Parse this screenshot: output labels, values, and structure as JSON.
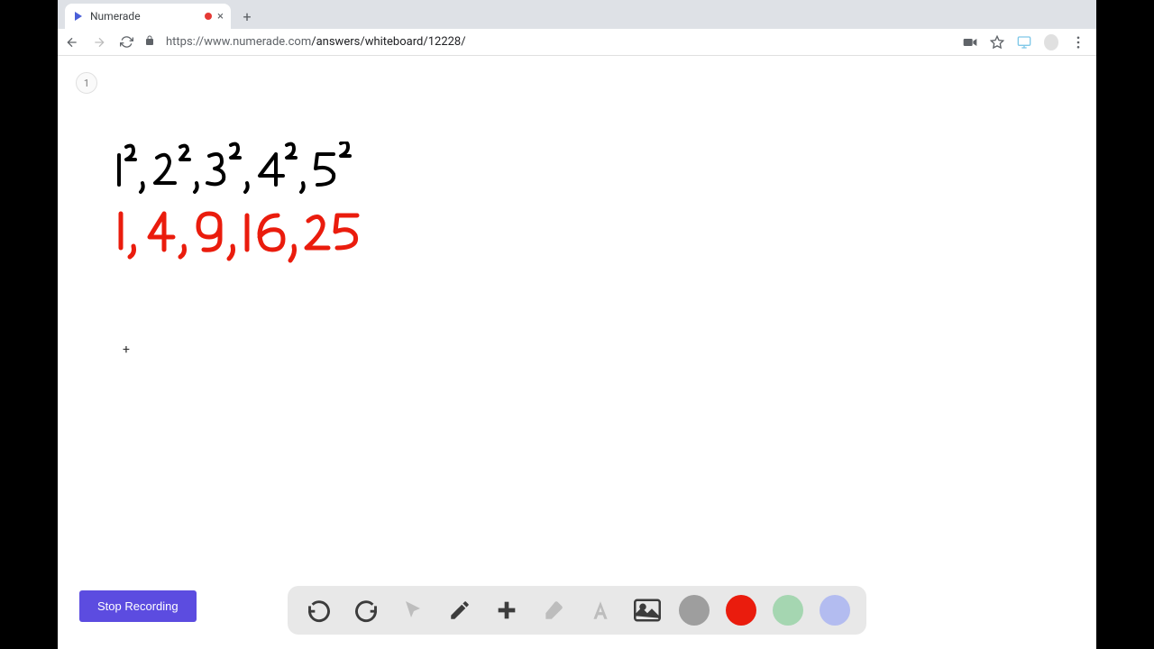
{
  "tab": {
    "title": "Numerade"
  },
  "address": {
    "scheme": "https://",
    "host": "www.numerade.com",
    "path": "/answers/whiteboard/12228/"
  },
  "page_number": "1",
  "stop_recording_label": "Stop Recording",
  "whiteboard": {
    "line1_black": "1², 2², 3², 4², 5²",
    "line2_red": "1, 4, 9, 16, 25"
  },
  "colors": {
    "gray": "#9e9e9e",
    "red": "#ea1c0d",
    "green": "#a5d6b1",
    "blue": "#b3bcf0"
  }
}
